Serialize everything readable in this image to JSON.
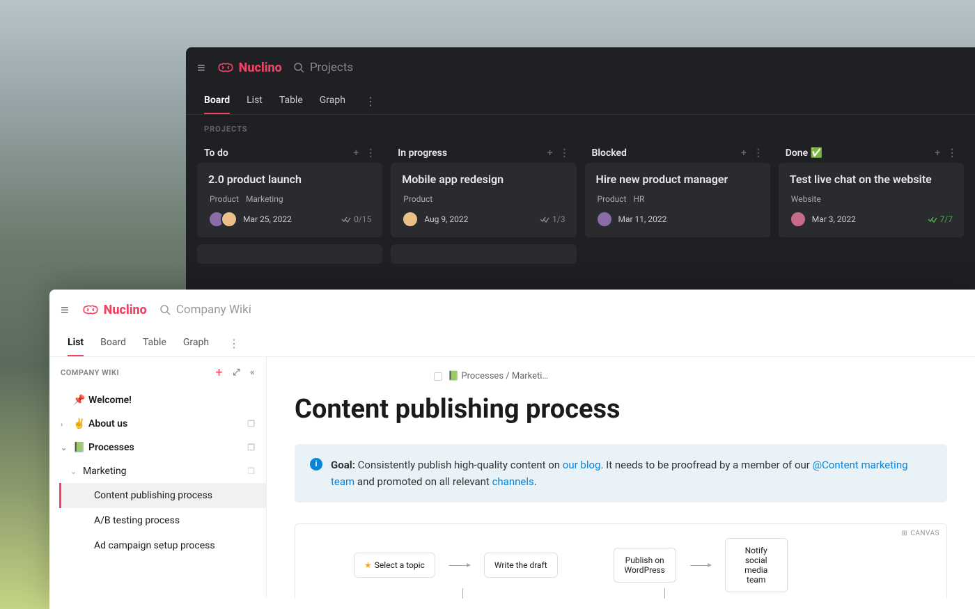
{
  "brand": "Nuclino",
  "brand_color": "#ef4365",
  "dark": {
    "search_placeholder": "Projects",
    "tabs": [
      "Board",
      "List",
      "Table",
      "Graph"
    ],
    "active_tab": 0,
    "section_label": "PROJECTS",
    "columns": [
      {
        "title": "To do",
        "cards": [
          {
            "title": "2.0 product launch",
            "tags": [
              "Product",
              "Marketing"
            ],
            "avatars": 2,
            "date": "Mar 25, 2022",
            "progress": "0/15",
            "done": false
          }
        ]
      },
      {
        "title": "In progress",
        "cards": [
          {
            "title": "Mobile app redesign",
            "tags": [
              "Product"
            ],
            "avatars": 1,
            "date": "Aug 9, 2022",
            "progress": "1/3",
            "done": false
          }
        ]
      },
      {
        "title": "Blocked",
        "cards": [
          {
            "title": "Hire new product manager",
            "tags": [
              "Product",
              "HR"
            ],
            "avatars": 1,
            "date": "Mar 11, 2022",
            "progress": "",
            "done": false
          }
        ]
      },
      {
        "title": "Done ✅",
        "cards": [
          {
            "title": "Test live chat on the website",
            "tags": [
              "Website"
            ],
            "avatars": 1,
            "date": "Mar 3, 2022",
            "progress": "7/7",
            "done": true
          }
        ]
      }
    ]
  },
  "light": {
    "search_placeholder": "Company Wiki",
    "tabs": [
      "List",
      "Board",
      "Table",
      "Graph"
    ],
    "active_tab": 0,
    "sidebar": {
      "label": "COMPANY WIKI",
      "items": {
        "welcome": "Welcome!",
        "about": "About us",
        "processes": "Processes",
        "marketing": "Marketing",
        "leaves": [
          "Content publishing process",
          "A/B testing process",
          "Ad campaign setup process"
        ]
      }
    },
    "breadcrumb": "📗 Processes / Marketi…",
    "doc_title": "Content publishing process",
    "callout": {
      "goal_label": "Goal:",
      "t1": " Consistently publish high-quality content on ",
      "link1": "our blog",
      "t2": ". It needs to be proofread by a member of our ",
      "link2": "@Content marketing team",
      "t3": " and promoted on all relevant ",
      "link3": "channels",
      "t4": "."
    },
    "canvas": {
      "label": "CANVAS",
      "nodes": [
        "Select a topic",
        "Write the draft",
        "Publish on WordPress",
        "Notify social media team"
      ]
    }
  }
}
